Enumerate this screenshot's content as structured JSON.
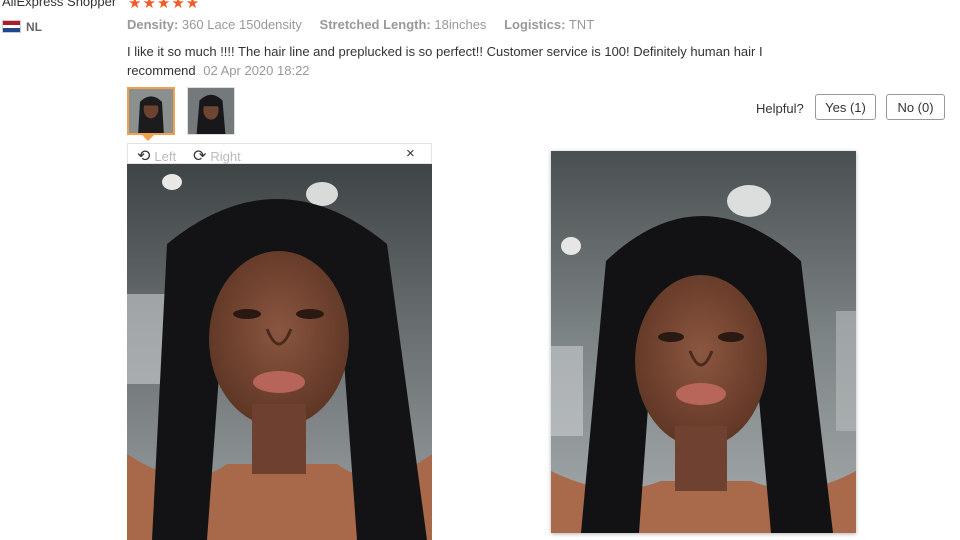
{
  "reviewer": {
    "name": "AliExpress Shopper",
    "stars": "★★★★★",
    "country": "NL"
  },
  "attributes": [
    {
      "key": "Density:",
      "value": "360 Lace 150density"
    },
    {
      "key": "Stretched Length:",
      "value": "18inches"
    },
    {
      "key": "Logistics:",
      "value": "TNT"
    }
  ],
  "review": {
    "text": "I like it so much !!!! The hair line and preplucked is so perfect!! Customer service is 100! Definitely human hair I recommend",
    "date": "02 Apr 2020 18:22"
  },
  "helpful": {
    "label": "Helpful?",
    "yes": "Yes (1)",
    "no": "No (0)"
  },
  "viewer": {
    "left": "Left",
    "right": "Right",
    "close": "×",
    "rotate_left_glyph": "⟲",
    "rotate_right_glyph": "⟳"
  },
  "colors": {
    "star": "#f15a24",
    "thumb_active_border": "#f0a14a"
  }
}
